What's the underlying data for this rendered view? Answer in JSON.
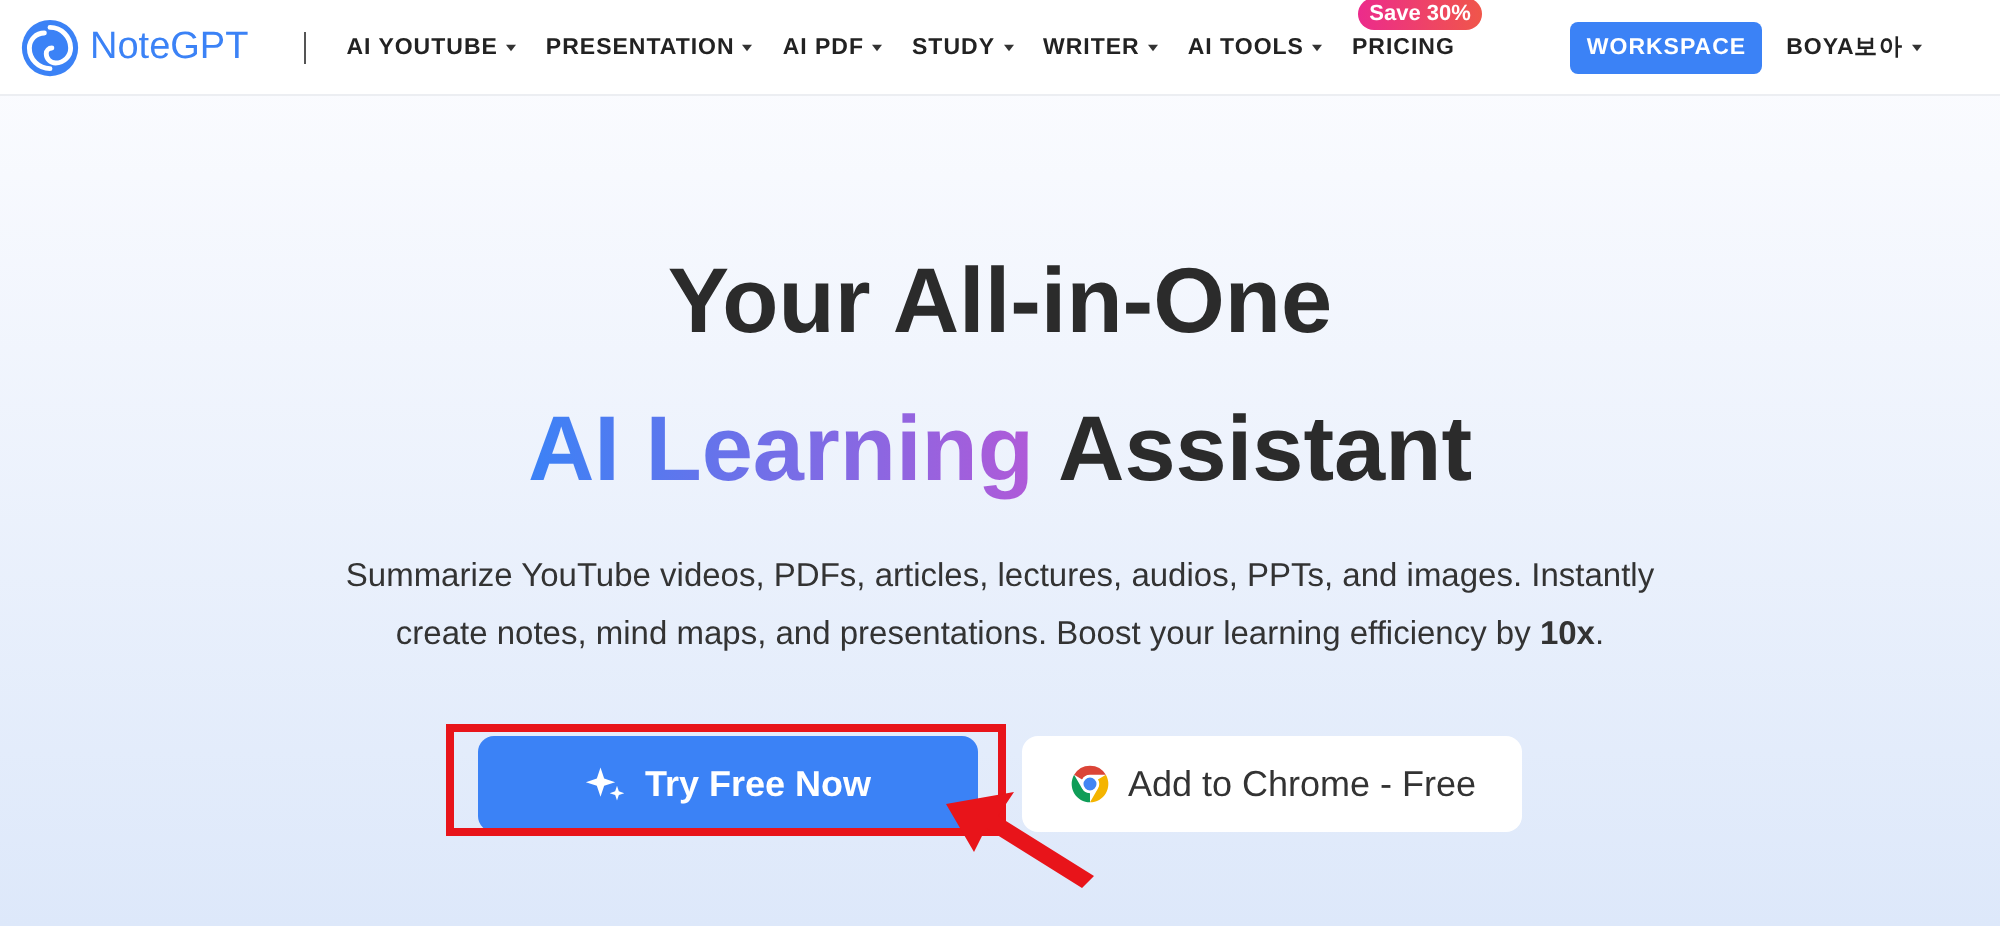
{
  "brand": {
    "name": "NoteGPT"
  },
  "nav": [
    {
      "label": "AI YOUTUBE",
      "dropdown": true
    },
    {
      "label": "PRESENTATION",
      "dropdown": true
    },
    {
      "label": "AI PDF",
      "dropdown": true
    },
    {
      "label": "STUDY",
      "dropdown": true
    },
    {
      "label": "WRITER",
      "dropdown": true
    },
    {
      "label": "AI TOOLS",
      "dropdown": true
    },
    {
      "label": "PRICING",
      "dropdown": false,
      "badge": "Save 30%"
    }
  ],
  "workspace_button": "WORKSPACE",
  "user": {
    "label": "BOYA보아",
    "dropdown": true
  },
  "hero": {
    "title_line1": "Your All-in-One",
    "title_highlight": "AI Learning",
    "title_rest": "Assistant",
    "subtitle": "Summarize YouTube videos, PDFs, articles, lectures, audios, PPTs, and images. Instantly create notes, mind maps, and presentations. Boost your learning efficiency by **10x**."
  },
  "buttons": [
    {
      "label": "Try Free Now",
      "kind": "primary"
    },
    {
      "label": "Add to Chrome - Free",
      "kind": "chrome"
    }
  ]
}
